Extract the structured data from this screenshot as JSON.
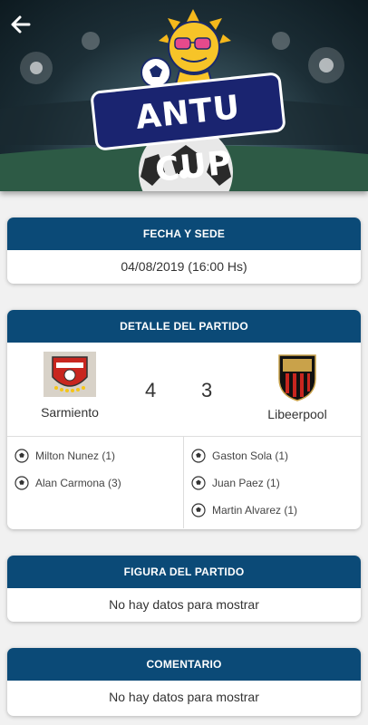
{
  "hero": {
    "logo_text": "ANTU CUP",
    "back_icon": "arrow-left-icon"
  },
  "match_info": {
    "title": "FECHA Y SEDE",
    "datetime": "04/08/2019 (16:00 Hs)"
  },
  "match_detail": {
    "title": "DETALLE DEL PARTIDO",
    "home": {
      "name": "Sarmiento",
      "score": "4"
    },
    "away": {
      "name": "Libeerpool",
      "score": "3"
    },
    "home_scorers": [
      {
        "label": "Milton Nunez (1)"
      },
      {
        "label": "Alan Carmona (3)"
      }
    ],
    "away_scorers": [
      {
        "label": "Gaston Sola (1)"
      },
      {
        "label": "Juan Paez (1)"
      },
      {
        "label": "Martin Alvarez (1)"
      }
    ]
  },
  "figure": {
    "title": "FIGURA DEL PARTIDO",
    "text": "No hay datos para mostrar"
  },
  "comment": {
    "title": "COMENTARIO",
    "text": "No hay datos para mostrar"
  },
  "colors": {
    "header": "#0b4a77",
    "background": "#f1f1f1"
  }
}
